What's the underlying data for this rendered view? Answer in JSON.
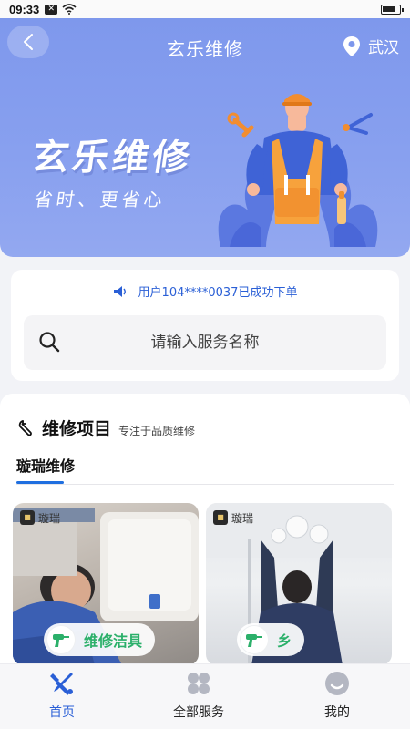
{
  "status_bar": {
    "time": "09:33",
    "battery_fraction": 0.75
  },
  "header": {
    "title": "玄乐维修",
    "location": "武汉"
  },
  "banner": {
    "brand": "玄乐维修",
    "slogan": "省时、更省心"
  },
  "notice": {
    "text": "用户104****0037已成功下单"
  },
  "search": {
    "placeholder": "请输入服务名称"
  },
  "repair_section": {
    "title": "维修项目",
    "subtitle": "专注于品质维修",
    "tabs": [
      {
        "label": "璇瑞维修",
        "active": true
      }
    ],
    "services": [
      {
        "label": "维修洁具",
        "badge": "璇瑞"
      },
      {
        "label": "乡",
        "badge": "璇瑞"
      }
    ]
  },
  "bottom_nav": {
    "items": [
      {
        "label": "首页",
        "icon": "tools-icon",
        "active": true
      },
      {
        "label": "全部服务",
        "icon": "grid-icon",
        "active": false
      },
      {
        "label": "我的",
        "icon": "smiley-icon",
        "active": false
      }
    ]
  },
  "colors": {
    "accent": "#2a5fd6",
    "hero": "#7d97ec",
    "service_label": "#2bb06a"
  }
}
